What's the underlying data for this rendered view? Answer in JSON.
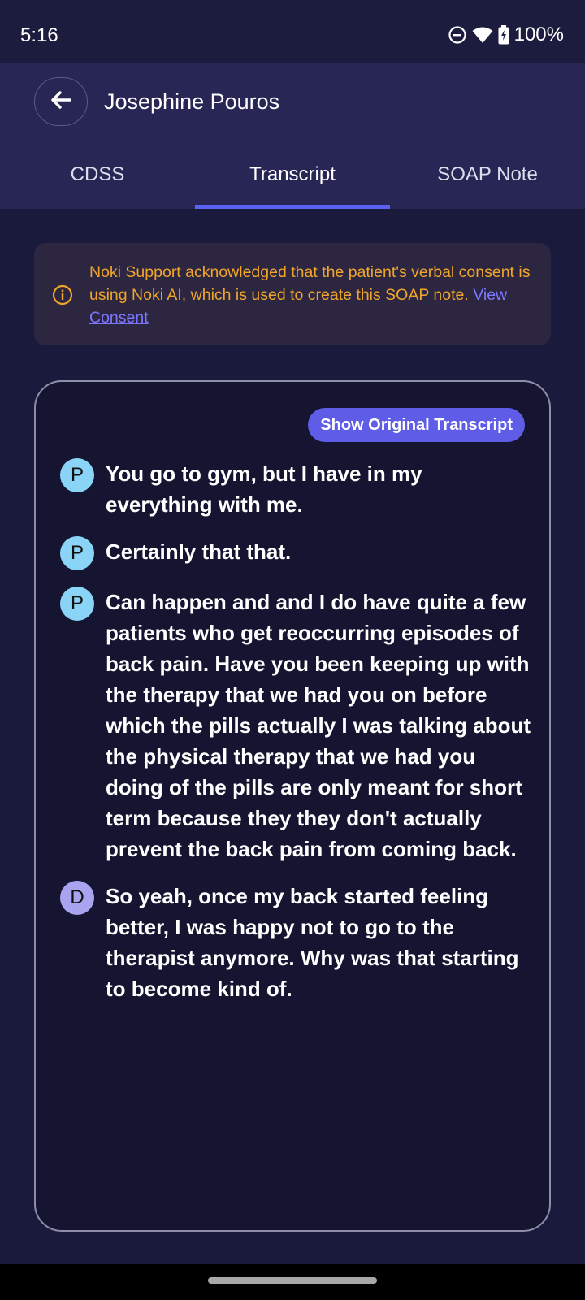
{
  "status_bar": {
    "time": "5:16",
    "battery": "100%",
    "icons": [
      "do-not-disturb-icon",
      "wifi-icon",
      "battery-charging-icon"
    ]
  },
  "header": {
    "title": "Josephine Pouros",
    "back_icon": "arrow-left-icon"
  },
  "tabs": [
    {
      "label": "CDSS",
      "active": false
    },
    {
      "label": "Transcript",
      "active": true
    },
    {
      "label": "SOAP Note",
      "active": false
    }
  ],
  "consent": {
    "icon": "info-icon",
    "text": "Noki Support acknowledged that the patient's verbal consent is using Noki AI, which is used to create this SOAP note. ",
    "link_label": "View Consent",
    "color": "#f0a62a",
    "link_color": "#7d78ff"
  },
  "transcript": {
    "show_original_label": "Show Original Transcript",
    "utterances": [
      {
        "speaker": "P",
        "text": "You go to gym, but I have in my everything with me."
      },
      {
        "speaker": "P",
        "text": "Certainly that that."
      },
      {
        "speaker": "P",
        "text": "Can happen and and I do have quite a few patients who get reoccurring episodes of back pain. Have you been keeping up with the therapy that we had you on before which the pills actually I was talking about the physical therapy that we had you doing of the pills are only meant for short term because they they don't actually prevent the back pain from coming back."
      },
      {
        "speaker": "D",
        "text": "So yeah, once my back started feeling better, I was happy not to go to the therapist anymore. Why was that starting to become kind of."
      }
    ]
  },
  "colors": {
    "background": "#1a1a3c",
    "header": "#272655",
    "accent": "#5a63f0",
    "button": "#5f5ce8",
    "patient_avatar": "#8ad5f7",
    "doctor_avatar": "#a9a4ef"
  }
}
